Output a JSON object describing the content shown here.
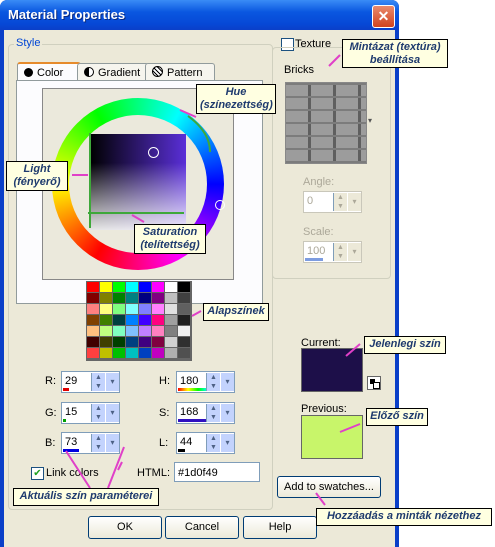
{
  "window": {
    "title": "Material Properties",
    "close": "✕"
  },
  "style_group": {
    "label": "Style"
  },
  "tabs": [
    {
      "label": "Color",
      "icon": "solid-circle-icon"
    },
    {
      "label": "Gradient",
      "icon": "half-circle-icon"
    },
    {
      "label": "Pattern",
      "icon": "pattern-globe-icon"
    }
  ],
  "texture": {
    "label": "Texture",
    "checked": false
  },
  "bricks": {
    "label": "Bricks"
  },
  "angle": {
    "label": "Angle:",
    "value": "0"
  },
  "scale": {
    "label": "Scale:",
    "value": "100"
  },
  "params": {
    "R": {
      "label": "R:",
      "value": "29"
    },
    "G": {
      "label": "G:",
      "value": "15"
    },
    "B": {
      "label": "B:",
      "value": "73"
    },
    "H": {
      "label": "H:",
      "value": "180"
    },
    "S": {
      "label": "S:",
      "value": "168"
    },
    "L": {
      "label": "L:",
      "value": "44"
    }
  },
  "link_colors": {
    "label": "Link colors",
    "checked": true
  },
  "html": {
    "label": "HTML:",
    "value": "#1d0f49"
  },
  "current": {
    "label": "Current:",
    "color": "#1d0f49"
  },
  "previous": {
    "label": "Previous:",
    "color": "#c8f56a"
  },
  "buttons": {
    "add": "Add to swatches...",
    "ok": "OK",
    "cancel": "Cancel",
    "help": "Help"
  },
  "swatches": [
    "#ff0000",
    "#ffff00",
    "#00ff00",
    "#00ffff",
    "#0000ff",
    "#ff00ff",
    "#ffffff",
    "#000000",
    "#800000",
    "#808000",
    "#008000",
    "#008080",
    "#000080",
    "#800080",
    "#c0c0c0",
    "#404040",
    "#ff8080",
    "#ffff80",
    "#80ff80",
    "#80ffff",
    "#8080ff",
    "#ff80ff",
    "#e0e0e0",
    "#606060",
    "#804000",
    "#408000",
    "#004040",
    "#0080ff",
    "#4000ff",
    "#ff0080",
    "#a0a0a0",
    "#202020",
    "#ffc080",
    "#c0ff80",
    "#80ffc0",
    "#80c0ff",
    "#c080ff",
    "#ff80c0",
    "#808080",
    "#f0f0f0",
    "#400000",
    "#404000",
    "#004000",
    "#004080",
    "#400080",
    "#800040",
    "#d0d0d0",
    "#303030",
    "#ff4040",
    "#c0c000",
    "#00c000",
    "#00c0c0",
    "#0040c0",
    "#c000c0",
    "#b0b0b0",
    "#505050"
  ],
  "callouts": {
    "texture": "Mintázat (textúra) beállítása",
    "hue": "Hue (színezettség)",
    "light": "Light (fényerő)",
    "saturation": "Saturation (telítettség)",
    "basic": "Alapszínek",
    "current": "Jelenlegi szín",
    "previous": "Előző szín",
    "params": "Aktuális szín paraméterei",
    "add": "Hozzáadás a minták nézethez"
  }
}
